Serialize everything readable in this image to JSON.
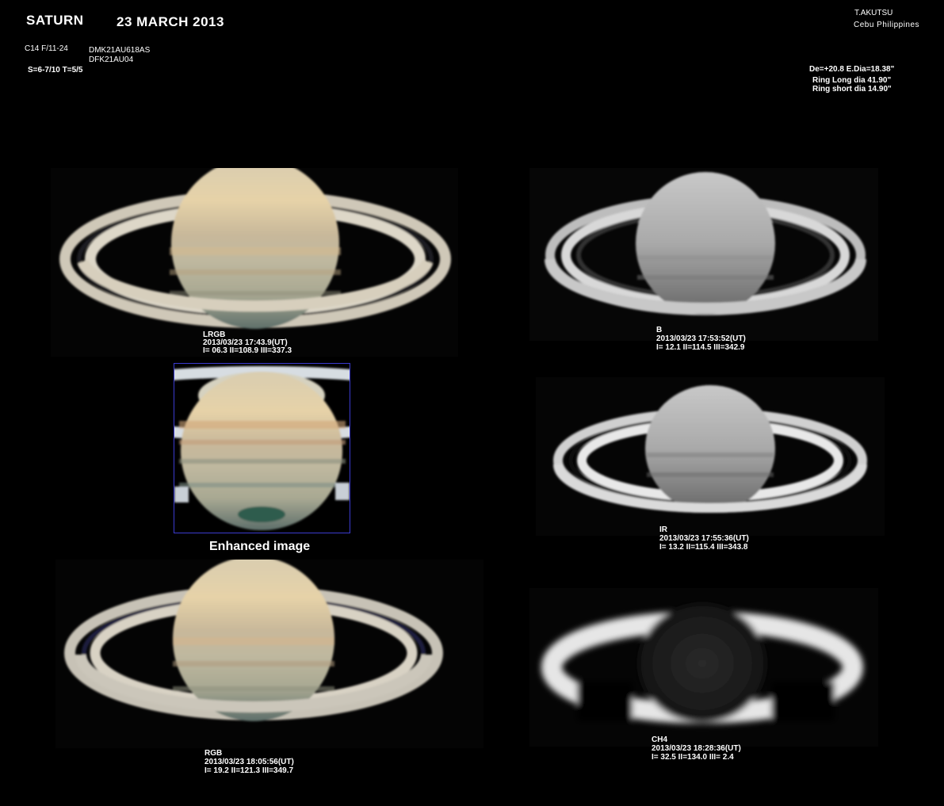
{
  "header": {
    "planet": "SATURN",
    "date": "23  MARCH   2013",
    "telescope": "C14  F/11-24",
    "camera1": "DMK21AU618AS",
    "camera2": "DFK21AU04",
    "seeing": "S=6-7/10    T=5/5",
    "observer": "T.AKUTSU",
    "location": "Cebu  Philippines",
    "de_line": "De=+20.8   E.Dia=18.38\"",
    "ring_long": "Ring Long  dia 41.90\"",
    "ring_short": "Ring short dia 14.90\""
  },
  "panels": {
    "lrgb": {
      "filter": "LRGB",
      "time": "2013/03/23 17:43.9(UT)",
      "cm": "I= 06.3 II=108.9 III=337.3"
    },
    "b": {
      "filter": "B",
      "time": "2013/03/23 17:53:52(UT)",
      "cm": "I= 12.1 II=114.5 III=342.9"
    },
    "ir": {
      "filter": "IR",
      "time": "2013/03/23 17:55:36(UT)",
      "cm": "I= 13.2 II=115.4 III=343.8"
    },
    "rgb": {
      "filter": "RGB",
      "time": "2013/03/23 18:05:56(UT)",
      "cm": "I= 19.2 II=121.3 III=349.7"
    },
    "ch4": {
      "filter": "CH4",
      "time": "2013/03/23 18:28:36(UT)",
      "cm": "I= 32.5 II=134.0 III=  2.4"
    },
    "enhanced": {
      "label": "Enhanced  image"
    }
  }
}
